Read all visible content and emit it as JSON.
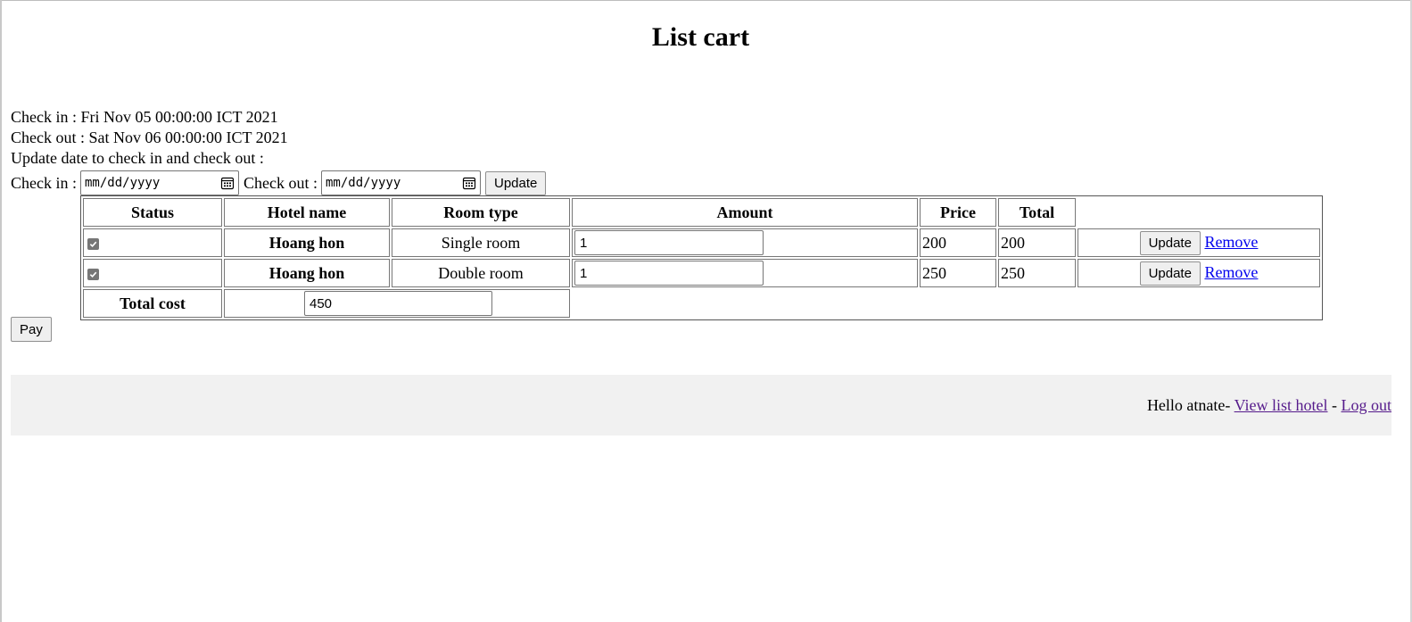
{
  "page": {
    "title": "List cart"
  },
  "booking": {
    "check_in_label": "Check in : Fri Nov 05 00:00:00 ICT 2021",
    "check_out_label": "Check out : Sat Nov 06 00:00:00 ICT 2021",
    "update_prompt": "Update date to check in and check out :",
    "check_in_field_label": "Check in :",
    "check_in_placeholder": "mm/dd/yyyy",
    "check_out_field_label": "Check out :",
    "check_out_placeholder": "mm/dd/yyyy",
    "update_button": "Update"
  },
  "cart": {
    "headers": [
      "Status",
      "Hotel name",
      "Room type",
      "Amount",
      "Price",
      "Total"
    ],
    "rows": [
      {
        "checked": true,
        "hotel": "Hoang hon",
        "room_type": "Single room",
        "amount": "1",
        "price": "200",
        "total": "200",
        "update_label": "Update",
        "remove_label": "Remove"
      },
      {
        "checked": true,
        "hotel": "Hoang hon",
        "room_type": "Double room",
        "amount": "1",
        "price": "250",
        "total": "250",
        "update_label": "Update",
        "remove_label": "Remove"
      }
    ],
    "total_cost_label": "Total cost",
    "total_cost_value": "450"
  },
  "actions": {
    "pay_button": "Pay"
  },
  "footer": {
    "greeting": "Hello atnate-",
    "view_list_hotel": "View list hotel",
    "separator": "-",
    "log_out": "Log out"
  },
  "icons": {
    "date_picker": "calendar-icon",
    "checkbox": "check-icon"
  }
}
